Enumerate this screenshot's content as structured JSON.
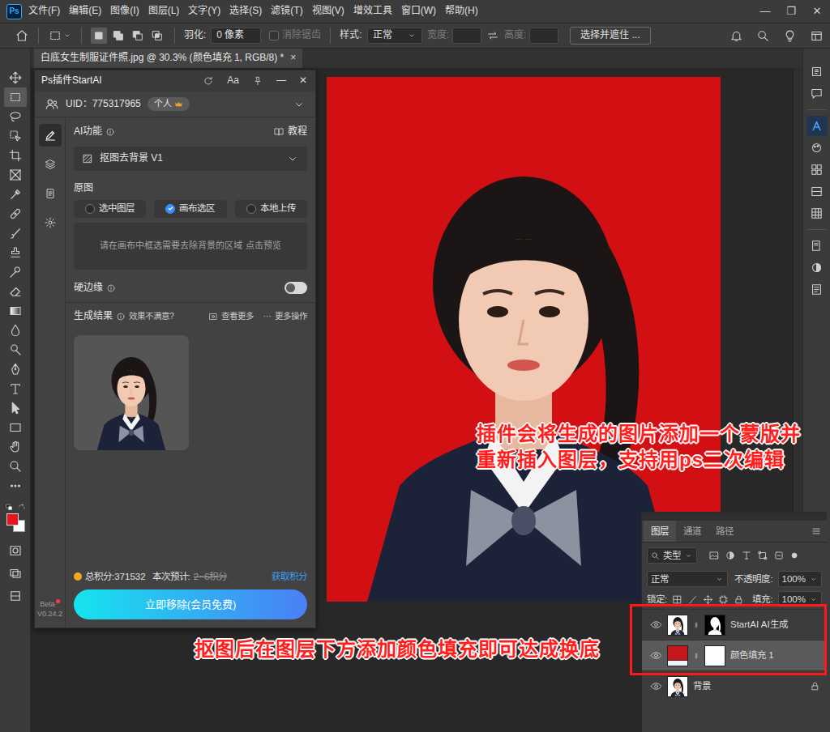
{
  "menu_bar": {
    "logo": "Ps",
    "menus": [
      "文件(F)",
      "编辑(E)",
      "图像(I)",
      "图层(L)",
      "文字(Y)",
      "选择(S)",
      "滤镜(T)",
      "视图(V)",
      "增效工具",
      "窗口(W)",
      "帮助(H)"
    ],
    "window_controls": [
      "—",
      "❐",
      "✕"
    ]
  },
  "options_bar": {
    "selection_modes": [
      {
        "kind": "new",
        "selected": true
      },
      {
        "kind": "add",
        "selected": false
      },
      {
        "kind": "subtract",
        "selected": false
      },
      {
        "kind": "intersect",
        "selected": false
      }
    ],
    "feather_label": "羽化:",
    "feather_value": "0 像素",
    "antialias": {
      "label": "消除锯齿",
      "checked": false,
      "disabled": true
    },
    "style_label": "样式:",
    "style_value": "正常",
    "width": {
      "label": "宽度:",
      "disabled": true
    },
    "height": {
      "label": "高度:",
      "disabled": true
    },
    "refine_button": "选择并遮住 ..."
  },
  "document_tab": {
    "title": "白底女生制服证件照.jpg @ 30.3% (颜色填充 1, RGB/8) *",
    "close": "×",
    "selected": true
  },
  "tools": {
    "items": [
      {
        "kind": "move",
        "selected": false
      },
      {
        "kind": "marquee",
        "selected": true
      },
      {
        "kind": "lasso",
        "selected": false
      },
      {
        "kind": "object",
        "selected": false
      },
      {
        "kind": "crop",
        "selected": false
      },
      {
        "kind": "frame",
        "selected": false
      },
      {
        "kind": "eyedropper",
        "selected": false
      },
      {
        "kind": "healing",
        "selected": false
      },
      {
        "kind": "brush",
        "selected": false
      },
      {
        "kind": "stamp",
        "selected": false
      },
      {
        "kind": "history",
        "selected": false
      },
      {
        "kind": "eraser",
        "selected": false
      },
      {
        "kind": "gradient",
        "selected": false
      },
      {
        "kind": "blur",
        "selected": false
      },
      {
        "kind": "dodge",
        "selected": false
      },
      {
        "kind": "pen",
        "selected": false
      },
      {
        "kind": "type",
        "selected": false
      },
      {
        "kind": "pathselect",
        "selected": false
      },
      {
        "kind": "rectangle",
        "selected": false
      },
      {
        "kind": "hand",
        "selected": false
      },
      {
        "kind": "zoom",
        "selected": false
      },
      {
        "kind": "more",
        "selected": false
      }
    ],
    "foreground": "#e8141a",
    "background": "#ffffff"
  },
  "dock": [
    {
      "kind": "history",
      "selected": false
    },
    {
      "kind": "comment",
      "selected": false
    },
    {
      "kind": "startai",
      "selected": true
    },
    {
      "kind": "color",
      "selected": false
    },
    {
      "kind": "swatches",
      "selected": false
    },
    {
      "kind": "gradients",
      "selected": false
    },
    {
      "kind": "patterns",
      "selected": false
    },
    {
      "kind": "libraries",
      "selected": false
    },
    {
      "kind": "adjustments",
      "selected": false
    },
    {
      "kind": "properties",
      "selected": false
    }
  ],
  "plugin": {
    "title": "Ps插件StartAI",
    "font_button": "Aa",
    "header_controls": [
      "—",
      "✕"
    ],
    "uid": "UID：775317965",
    "account_badge": "个人",
    "side_tabs": [
      {
        "kind": "pen",
        "selected": true
      },
      {
        "kind": "layers",
        "selected": false
      },
      {
        "kind": "document",
        "selected": false
      },
      {
        "kind": "settings",
        "selected": false
      }
    ],
    "ai_label": "AI功能",
    "tutorial": "教程",
    "feature": "抠图去背景 V1",
    "source_label": "原图",
    "source_options": [
      {
        "label": "选中图层",
        "selected": false
      },
      {
        "label": "画布选区",
        "selected": true
      },
      {
        "label": "本地上传",
        "selected": false
      }
    ],
    "hint": "请在画布中框选需要去除背景的区域 点击预览",
    "hard_edge": {
      "label": "硬边缘",
      "on": false
    },
    "results_label": "生成结果",
    "unsatisfied": "效果不满意?",
    "view_more": "查看更多",
    "more_icon": "···",
    "more_actions": "更多操作",
    "points_total": "总积分:371532",
    "estimate_label": "本次预计:",
    "estimate_value": "2~6积分",
    "estimate_struck": true,
    "get_points": "获取积分",
    "action_button": "立即移除(会员免费)",
    "beta": "Beta",
    "version": "V0.24.2"
  },
  "layers_panel": {
    "tabs": [
      {
        "label": "图层",
        "selected": true
      },
      {
        "label": "通道",
        "selected": false
      },
      {
        "label": "路径",
        "selected": false
      }
    ],
    "filter_kind": "类型",
    "blend_mode": "正常",
    "opacity_label": "不透明度:",
    "opacity": "100%",
    "lock_label": "锁定:",
    "fill_label": "填充:",
    "fill": "100%",
    "layers": [
      {
        "name": "StartAI AI生成",
        "kind": "masked-image",
        "visible": true,
        "selected": false,
        "locked": false
      },
      {
        "name": "颜色填充 1",
        "kind": "color-fill",
        "visible": true,
        "selected": true,
        "locked": false
      },
      {
        "name": "背景",
        "kind": "image",
        "visible": true,
        "selected": false,
        "locked": true
      }
    ]
  },
  "annotations": [
    {
      "lines": [
        "插件会将生成的图片添加一个蒙版并",
        "重新插入图层，支持用ps二次编辑"
      ]
    },
    {
      "lines": [
        "抠图后在图层下方添加颜色填充即可达成换底"
      ]
    }
  ]
}
